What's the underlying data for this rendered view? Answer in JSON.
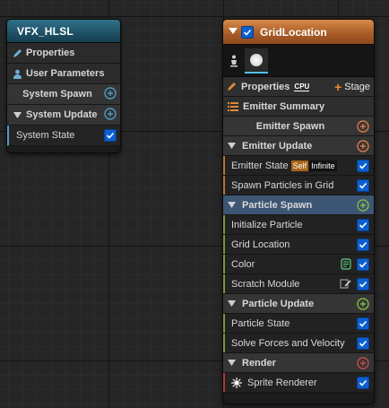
{
  "system_node": {
    "title": "VFX_HLSL",
    "rows": {
      "properties": "Properties",
      "user_parameters": "User Parameters",
      "system_spawn": "System Spawn",
      "system_update": "System Update",
      "system_state": "System State"
    }
  },
  "emitter_node": {
    "title": "GridLocation",
    "properties_label": "Properties",
    "sim_target": "CPU",
    "stage_button": "Stage",
    "emitter_summary": "Emitter Summary",
    "emitter_spawn": "Emitter Spawn",
    "emitter_update": "Emitter Update",
    "emitter_state": {
      "label": "Emitter State",
      "tag_self": "Self",
      "tag_infinite": "Infinite"
    },
    "spawn_particles_in_grid": "Spawn Particles in Grid",
    "particle_spawn": "Particle Spawn",
    "initialize_particle": "Initialize Particle",
    "grid_location": "Grid Location",
    "color": "Color",
    "scratch_module": "Scratch Module",
    "particle_update": "Particle Update",
    "particle_state": "Particle State",
    "solve_forces": "Solve Forces and Velocity",
    "render": "Render",
    "sprite_renderer": "Sprite Renderer"
  },
  "colors": {
    "system_header": "#1c4c60",
    "emitter_header": "#a65a26",
    "checkbox": "#0d5fcf",
    "spawn_accent": "#b7743a",
    "update_accent": "#6f9a3b",
    "render_accent": "#a73a3a",
    "selected_row": "#3c5674"
  }
}
